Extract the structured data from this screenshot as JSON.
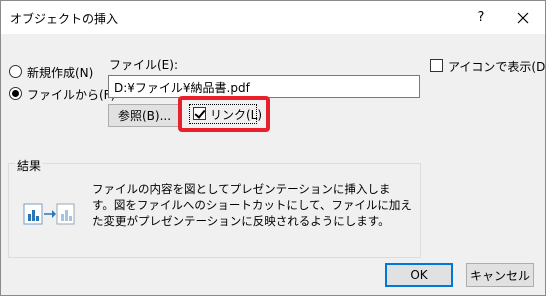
{
  "titlebar": {
    "title": "オブジェクトの挿入",
    "help": "?",
    "close_icon": "close-icon"
  },
  "options": {
    "create_new": {
      "label": "新規作成(N)",
      "selected": false
    },
    "create_from_file": {
      "label": "ファイルから(F)",
      "selected": true
    }
  },
  "file": {
    "label": "ファイル(E):",
    "value": "D:¥ファイル¥納品書.pdf"
  },
  "browse_button": "参照(B)...",
  "link_checkbox": {
    "label": "リンク(L)",
    "checked": true
  },
  "display_as_icon": {
    "label": "アイコンで表示(D)",
    "checked": false
  },
  "result": {
    "title": "結果",
    "text": "ファイルの内容を図としてプレゼンテーションに挿入します。図をファイルへのショートカットにして、ファイルに加えた変更がプレゼンテーションに反映されるようにします。",
    "icon": "linked-chart-icon"
  },
  "buttons": {
    "ok": "OK",
    "cancel": "キャンセル"
  },
  "colors": {
    "highlight": "#e8202a",
    "default_button_border": "#0078d7"
  }
}
